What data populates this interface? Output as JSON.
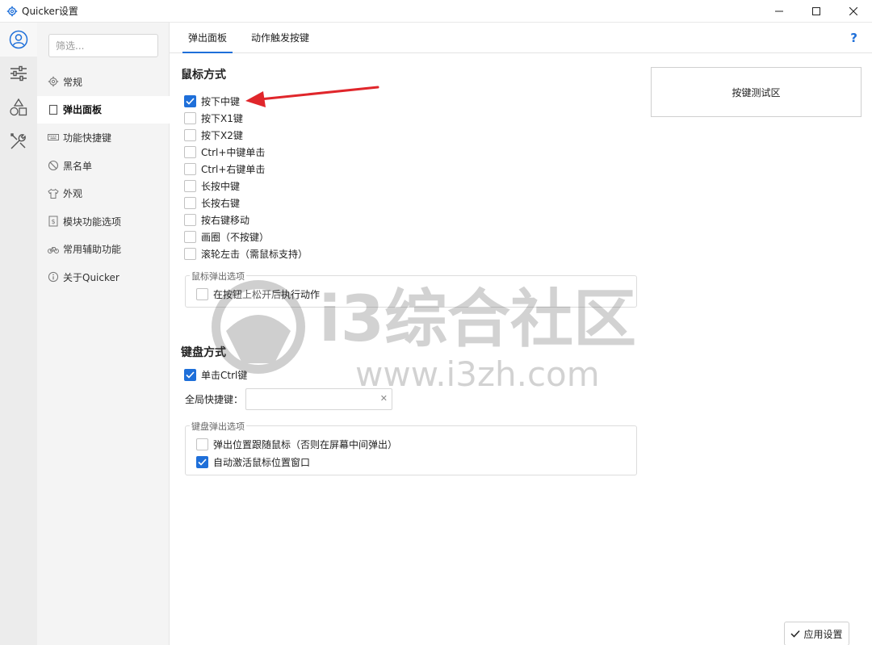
{
  "window": {
    "title": "Quicker设置"
  },
  "sidebar": {
    "filter_placeholder": "筛选...",
    "items": [
      {
        "label": "常规",
        "icon": "gear-icon"
      },
      {
        "label": "弹出面板",
        "icon": "panel-icon"
      },
      {
        "label": "功能快捷键",
        "icon": "keyboard-icon"
      },
      {
        "label": "黑名单",
        "icon": "block-icon"
      },
      {
        "label": "外观",
        "icon": "shirt-icon"
      },
      {
        "label": "模块功能选项",
        "icon": "module-icon"
      },
      {
        "label": "常用辅助功能",
        "icon": "bicycle-icon"
      },
      {
        "label": "关于Quicker",
        "icon": "info-icon"
      }
    ],
    "active_index": 1
  },
  "tabs": [
    {
      "label": "弹出面板",
      "active": true
    },
    {
      "label": "动作触发按键",
      "active": false
    }
  ],
  "help_label": "?",
  "mouse": {
    "title": "鼠标方式",
    "options": [
      {
        "label": "按下中键",
        "checked": true
      },
      {
        "label": "按下X1键",
        "checked": false
      },
      {
        "label": "按下X2键",
        "checked": false
      },
      {
        "label": "Ctrl+中键单击",
        "checked": false
      },
      {
        "label": "Ctrl+右键单击",
        "checked": false
      },
      {
        "label": "长按中键",
        "checked": false
      },
      {
        "label": "长按右键",
        "checked": false
      },
      {
        "label": "按右键移动",
        "checked": false
      },
      {
        "label": "画圈（不按键）",
        "checked": false
      },
      {
        "label": "滚轮左击（需鼠标支持）",
        "checked": false
      }
    ],
    "popup_group": {
      "label": "鼠标弹出选项",
      "options": [
        {
          "label": "在按钮上松开后执行动作",
          "checked": false
        }
      ]
    }
  },
  "keyboard": {
    "title": "键盘方式",
    "option": {
      "label": "单击Ctrl键",
      "checked": true
    },
    "hotkey_label": "全局快捷键：",
    "hotkey_value": "",
    "popup_group": {
      "label": "键盘弹出选项",
      "options": [
        {
          "label": "弹出位置跟随鼠标（否则在屏幕中间弹出）",
          "checked": false
        },
        {
          "label": "自动激活鼠标位置窗口",
          "checked": true
        }
      ]
    }
  },
  "test_area_label": "按键测试区",
  "apply_label": "应用设置",
  "watermark": {
    "text": "i3综合社区",
    "url": "www.i3zh.com"
  },
  "colors": {
    "accent": "#1e6fd9",
    "arrow": "#e0262b"
  }
}
